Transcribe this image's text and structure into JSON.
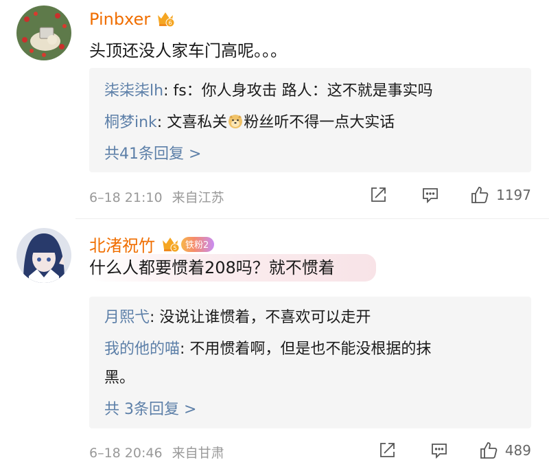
{
  "comments": [
    {
      "username": "Pinbxer",
      "crown_level": "6",
      "text": "头顶还没人家车门高呢。。。",
      "replies": [
        {
          "user": "柒柒柒lh",
          "text": "fs：你人身攻击 路人：这不就是事实吗"
        },
        {
          "user": "桐梦ink",
          "text": "文喜私关",
          "emoji": "doge-emoji",
          "text_after": "粉丝听不得一点大实话"
        }
      ],
      "more_replies": "共41条回复 >",
      "time": "6–18 21:10",
      "location": "来自江苏",
      "likes": "1197"
    },
    {
      "username": "北渚祝竹",
      "crown_level": "5",
      "fan_badge": "铁粉2",
      "text": "什么人都要惯着208吗？就不惯着",
      "replies": [
        {
          "user": "月熙弋",
          "text": "没说让谁惯着，不喜欢可以走开"
        },
        {
          "user": "我的他的喵",
          "text": "不用惯着啊，但是也不能没根据的抹",
          "text_cont": "黑。"
        }
      ],
      "more_replies": "共 3条回复 >",
      "time": "6–18 20:46",
      "location": "来自甘肃",
      "likes": "489"
    }
  ],
  "colors": {
    "username": "#f06e00",
    "reply_user": "#5c7fa8",
    "meta": "#999999",
    "reply_bg": "#f5f5f5"
  },
  "icons": [
    "share-icon",
    "comment-icon",
    "like-icon",
    "crown-badge-icon"
  ]
}
